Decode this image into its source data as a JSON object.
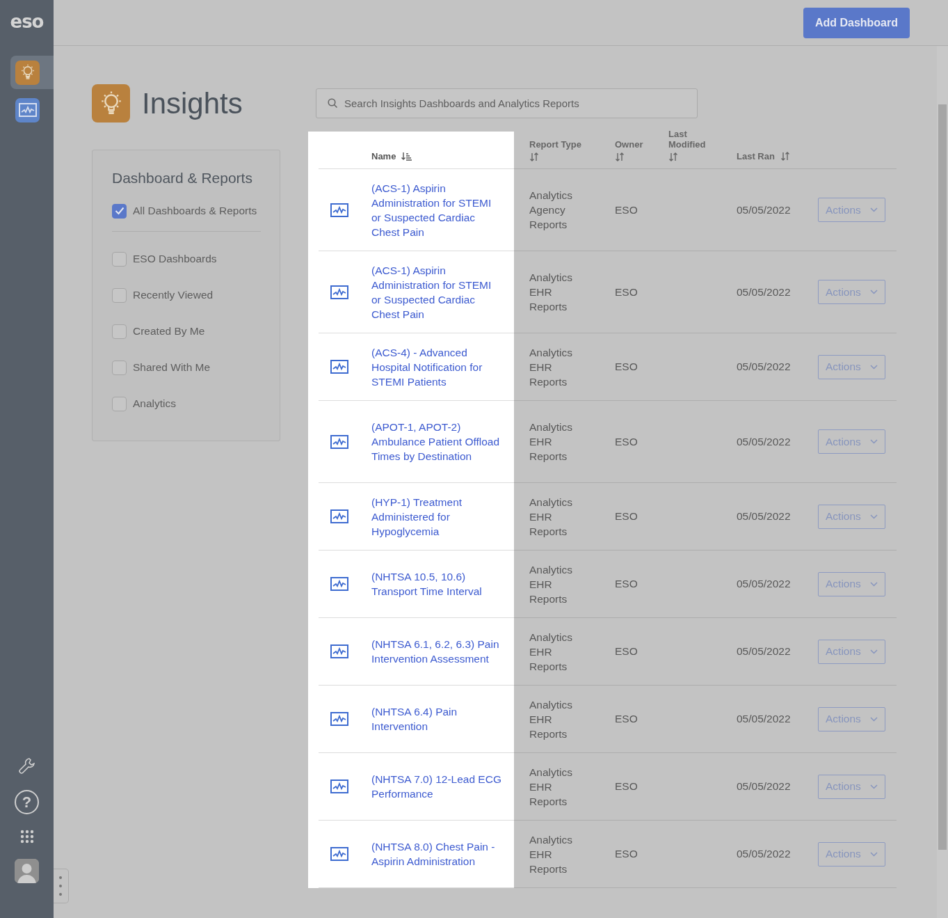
{
  "sidebar": {
    "logo": "eso",
    "apps": [
      {
        "kind": "insights",
        "selected": true
      },
      {
        "kind": "analytics",
        "selected": false
      }
    ],
    "help": "?"
  },
  "topbar": {
    "add_button": "Add Dashboard"
  },
  "header": {
    "title": "Insights",
    "search": {
      "placeholder": "Search Insights Dashboards and Analytics Reports"
    }
  },
  "filters": {
    "title": "Dashboard & Reports",
    "items": [
      {
        "label": "All Dashboards & Reports",
        "checked": true
      },
      {
        "label": "ESO Dashboards",
        "checked": false
      },
      {
        "label": "Recently Viewed",
        "checked": false
      },
      {
        "label": "Created By Me",
        "checked": false
      },
      {
        "label": "Shared With Me",
        "checked": false
      },
      {
        "label": "Analytics",
        "checked": false
      }
    ]
  },
  "table": {
    "columns": [
      {
        "label": "Name",
        "sorted": true
      },
      {
        "label": "Report Type",
        "sorted": false
      },
      {
        "label": "Owner",
        "sorted": false
      },
      {
        "label": "Last Modified",
        "sorted": false
      },
      {
        "label": "Last Ran",
        "sorted": false
      }
    ],
    "rows": [
      {
        "name": "(ACS-1) Aspirin Administration for STEMI or Suspected Cardiac Chest Pain",
        "report_type": "Analytics Agency Reports",
        "owner": "ESO",
        "last_ran": "05/05/2022",
        "action": "Actions"
      },
      {
        "name": "(ACS-1) Aspirin Administration for STEMI or Suspected Cardiac Chest Pain",
        "report_type": "Analytics EHR Reports",
        "owner": "ESO",
        "last_ran": "05/05/2022",
        "action": "Actions"
      },
      {
        "name": "(ACS-4) - Advanced Hospital Notification for STEMI Patients",
        "report_type": "Analytics EHR Reports",
        "owner": "ESO",
        "last_ran": "05/05/2022",
        "action": "Actions"
      },
      {
        "name": "(APOT-1, APOT-2) Ambulance Patient Offload Times by Destination",
        "report_type": "Analytics EHR Reports",
        "owner": "ESO",
        "last_ran": "05/05/2022",
        "action": "Actions"
      },
      {
        "name": "(HYP-1) Treatment Administered for Hypoglycemia",
        "report_type": "Analytics EHR Reports",
        "owner": "ESO",
        "last_ran": "05/05/2022",
        "action": "Actions"
      },
      {
        "name": "(NHTSA 10.5, 10.6) Transport Time Interval",
        "report_type": "Analytics EHR Reports",
        "owner": "ESO",
        "last_ran": "05/05/2022",
        "action": "Actions"
      },
      {
        "name": "(NHTSA 6.1, 6.2, 6.3) Pain Intervention Assessment",
        "report_type": "Analytics EHR Reports",
        "owner": "ESO",
        "last_ran": "05/05/2022",
        "action": "Actions"
      },
      {
        "name": "(NHTSA 6.4) Pain Intervention",
        "report_type": "Analytics EHR Reports",
        "owner": "ESO",
        "last_ran": "05/05/2022",
        "action": "Actions"
      },
      {
        "name": "(NHTSA 7.0) 12-Lead ECG Performance",
        "report_type": "Analytics EHR Reports",
        "owner": "ESO",
        "last_ran": "05/05/2022",
        "action": "Actions"
      },
      {
        "name": "(NHTSA 8.0) Chest Pain - Aspirin Administration",
        "report_type": "Analytics EHR Reports",
        "owner": "ESO",
        "last_ran": "05/05/2022",
        "action": "Actions"
      }
    ]
  }
}
